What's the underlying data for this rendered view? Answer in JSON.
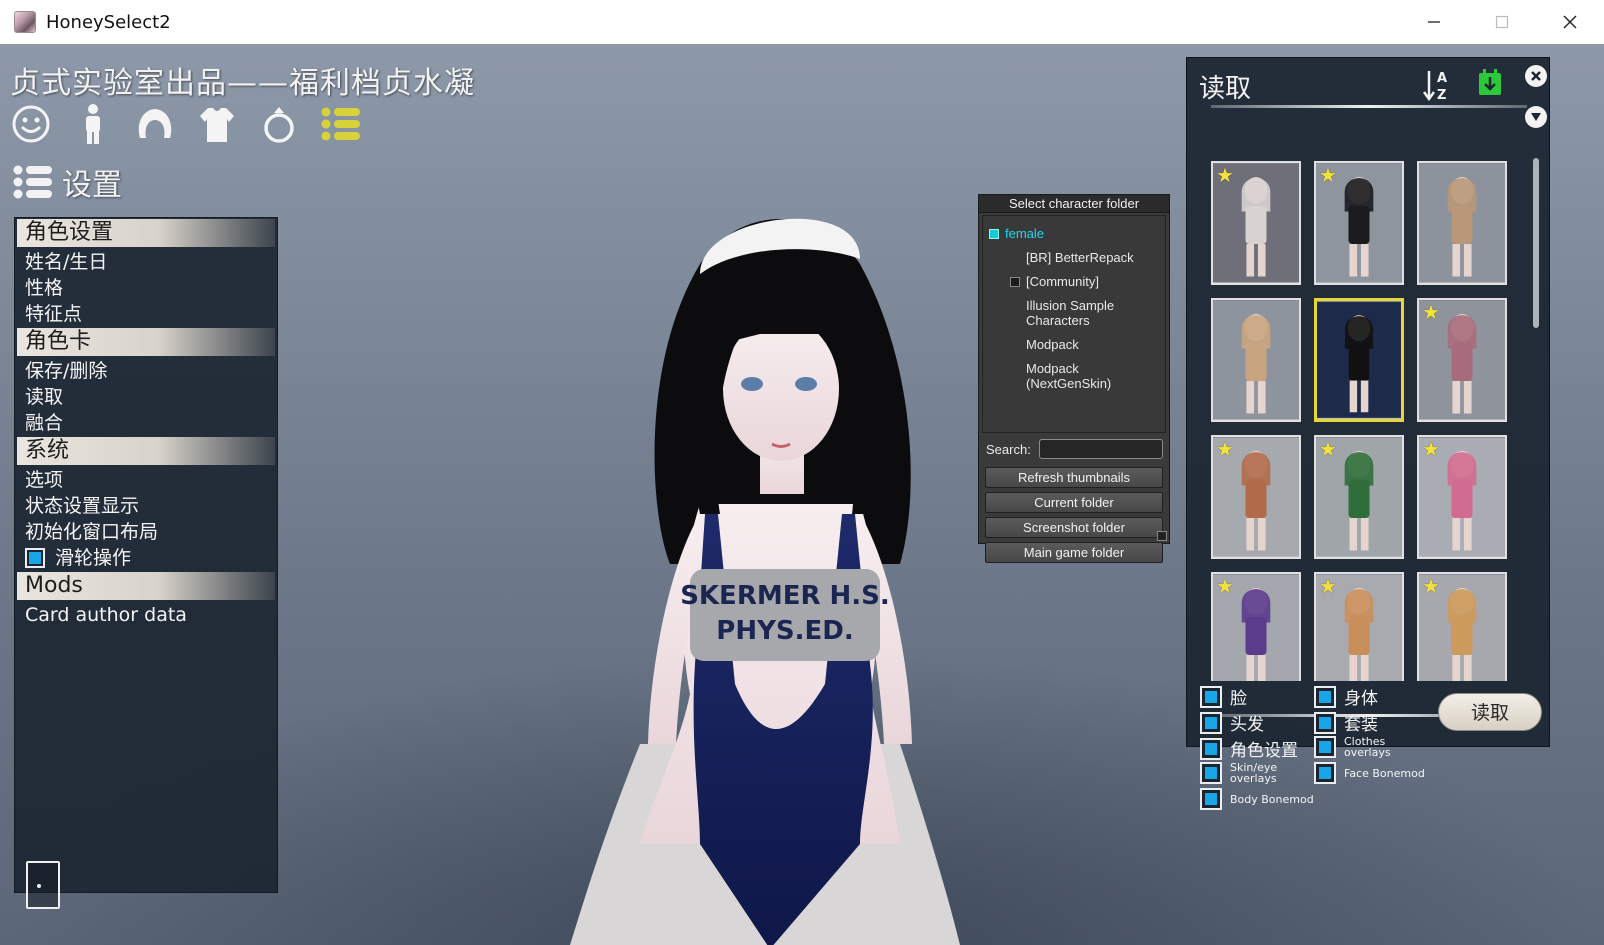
{
  "window": {
    "title": "HoneySelect2",
    "controls": [
      "minimize-icon",
      "maximize-icon",
      "close-icon"
    ]
  },
  "brand": {
    "text": "贞式实验室出品——福利档贞水凝"
  },
  "toolbar": {
    "icons": [
      "smiley-face-icon",
      "body-icon",
      "hair-icon",
      "shirt-icon",
      "ring-icon",
      "list-icon"
    ],
    "active_color": "#d7d23a"
  },
  "settings": {
    "title": "设置",
    "icon": "list-icon"
  },
  "menu": {
    "sections": [
      {
        "title": "角色设置",
        "items": [
          "姓名/生日",
          "性格",
          "特征点"
        ]
      },
      {
        "title": "角色卡",
        "items": [
          "保存/删除",
          "读取",
          "融合"
        ]
      },
      {
        "title": "系统",
        "items": [
          "选项",
          "状态设置显示",
          "初始化窗口布局"
        ],
        "checkbox_item": {
          "label": "滑轮操作",
          "checked": true
        }
      },
      {
        "title": "Mods",
        "items": [
          "Card author data"
        ]
      }
    ]
  },
  "folder_dialog": {
    "title": "Select character folder",
    "tree": [
      {
        "label": "female",
        "selected": true,
        "toggle": true
      },
      {
        "label": "[BR] BetterRepack",
        "selected": false,
        "toggle": false
      },
      {
        "label": "[Community]",
        "selected": false,
        "toggle": true
      },
      {
        "label": "Illusion Sample Characters",
        "selected": false,
        "toggle": false
      },
      {
        "label": "Modpack",
        "selected": false,
        "toggle": false
      },
      {
        "label": "Modpack (NextGenSkin)",
        "selected": false,
        "toggle": false
      }
    ],
    "search_label": "Search:",
    "search_value": "",
    "buttons": [
      "Refresh thumbnails",
      "Current folder",
      "Screenshot folder",
      "Main game folder"
    ]
  },
  "load_panel": {
    "title": "读取",
    "sort_icon": "sort-az-icon",
    "save_icon": "download-icon",
    "accent": "#2cc93a",
    "cards": [
      {
        "starred": true,
        "selected": false
      },
      {
        "starred": true,
        "selected": false
      },
      {
        "starred": false,
        "selected": false
      },
      {
        "starred": false,
        "selected": false
      },
      {
        "starred": false,
        "selected": true
      },
      {
        "starred": true,
        "selected": false
      },
      {
        "starred": true,
        "selected": false
      },
      {
        "starred": true,
        "selected": false
      },
      {
        "starred": true,
        "selected": false
      },
      {
        "starred": true,
        "selected": false
      },
      {
        "starred": true,
        "selected": false
      },
      {
        "starred": true,
        "selected": false
      }
    ],
    "options": [
      {
        "label": "脸",
        "checked": true
      },
      {
        "label": "身体",
        "checked": true
      },
      {
        "label": "头发",
        "checked": true
      },
      {
        "label": "套装",
        "checked": true
      },
      {
        "label": "角色设置",
        "checked": true
      },
      {
        "label": "Clothes overlays",
        "checked": true
      },
      {
        "label": "Skin/eye overlays",
        "checked": true
      },
      {
        "label": "Face Bonemod",
        "checked": true
      },
      {
        "label": "Body Bonemod",
        "checked": true
      }
    ],
    "load_button": "读取"
  },
  "exit_icon": "door-icon"
}
